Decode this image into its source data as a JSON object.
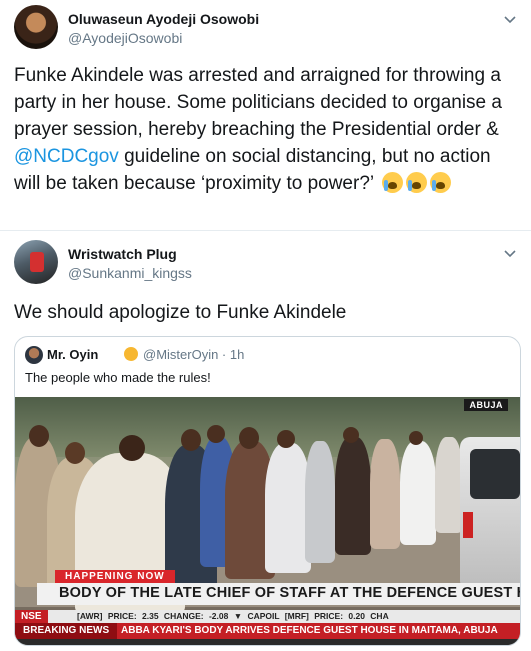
{
  "tweet1": {
    "name": "Oluwaseun Ayodeji Osowobi",
    "handle": "@AyodejiOsowobi",
    "text_before": "Funke Akindele was arrested and arraigned for throwing a party in her house. Some politicians decided to organise a prayer session, hereby breaching the Presidential order & ",
    "mention": "@NCDCgov",
    "text_after": " guideline on social distancing, but no action will be taken because ‘proximity to power?’"
  },
  "tweet2": {
    "name": "Wristwatch Plug",
    "handle": "@Sunkanmi_kingss",
    "text": "We should apologize to Funke Akindele",
    "quote": {
      "name": "Mr. Oyin",
      "handle_time": "@MisterOyin · 1h",
      "text": "The people who made the rules!",
      "image": {
        "location_tag": "ABUJA",
        "happening_now": "HAPPENING NOW",
        "headline": "BODY OF THE LATE CHIEF OF STAFF AT THE DEFENCE GUEST HOUSE",
        "ticker_label": "NSE",
        "ticker_quotes": "[AWR]  PRICE: 2.35  CHANGE: -2.08 ▼  CAPOIL [MRF]  PRICE: 0.20  CHA",
        "breaking_label": "BREAKING NEWS",
        "breaking_text": "ABBA KYARI'S BODY ARRIVES DEFENCE GUEST HOUSE IN MAITAMA, ABUJA"
      }
    }
  }
}
